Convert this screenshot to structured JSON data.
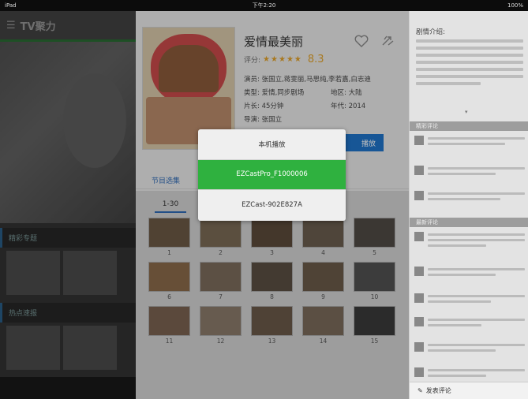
{
  "status_bar": {
    "device": "iPad",
    "time": "下午2:20",
    "battery": "100%"
  },
  "background_app": {
    "logo": "TV聚力",
    "section_1": "精彩专题",
    "section_2": "热点速报"
  },
  "detail": {
    "title": "爱情最美丽",
    "rating_label": "评分:",
    "stars": "★★★★★",
    "score": "8.3",
    "cast": "演员: 张国立,蒋雯丽,马思纯,李若嘉,白志迪",
    "genre_label": "类型: 爱情,同步剧场",
    "region_label": "地区: 大陆",
    "duration_label": "片长: 45分钟",
    "year_label": "年代: 2014",
    "director_label": "导演: 张国立",
    "play_button": "播放"
  },
  "tabs": {
    "episodes_tab": "节目选集",
    "range_tab": "1-30"
  },
  "episodes": [
    "1",
    "2",
    "3",
    "4",
    "5",
    "6",
    "7",
    "8",
    "9",
    "10",
    "11",
    "12",
    "13",
    "14",
    "15"
  ],
  "popup": {
    "options": [
      "本机播放",
      "EZCastPro_F1000006",
      "EZCast-902E827A"
    ],
    "selected_index": 1
  },
  "right_panel": {
    "title": "剧情介绍:",
    "section_hot": "精彩评论",
    "section_latest": "最新评论",
    "compose_label": "发表评论"
  }
}
